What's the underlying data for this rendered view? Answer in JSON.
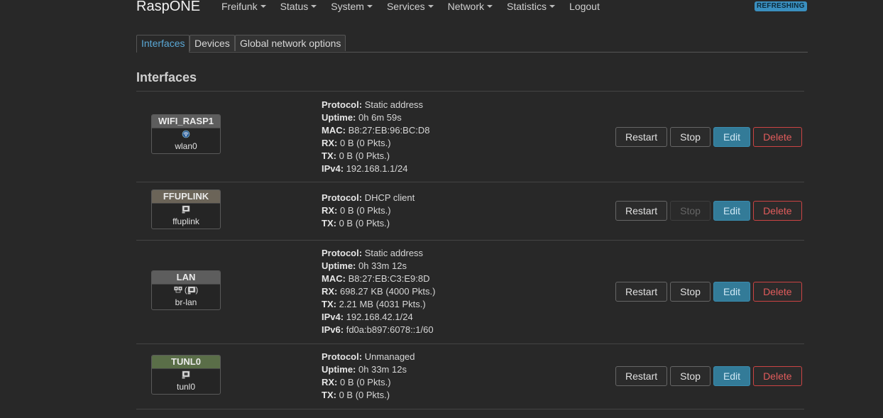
{
  "header": {
    "brand": "RaspONE",
    "nav": [
      "Freifunk",
      "Status",
      "System",
      "Services",
      "Network",
      "Statistics",
      "Logout"
    ],
    "badge": "REFRESHING"
  },
  "tabs": [
    "Interfaces",
    "Devices",
    "Global network options"
  ],
  "section_title": "Interfaces",
  "labels": {
    "protocol": "Protocol:",
    "uptime": "Uptime:",
    "mac": "MAC:",
    "rx": "RX:",
    "tx": "TX:",
    "ipv4": "IPv4:",
    "ipv6": "IPv6:"
  },
  "buttons": {
    "restart": "Restart",
    "stop": "Stop",
    "edit": "Edit",
    "delete": "Delete"
  },
  "colors": {
    "accent": "#3a8fbf",
    "delete": "#e25c5c"
  },
  "interfaces": [
    {
      "name": "WIFI_RASP1",
      "header_color": "#5d5d5d",
      "icon": "wifi-icon",
      "device": "wlan0",
      "protocol": "Static address",
      "uptime": "0h 6m 59s",
      "mac": "B8:27:EB:96:BC:D8",
      "rx": "0 B (0 Pkts.)",
      "tx": "0 B (0 Pkts.)",
      "ipv4": "192.168.1.1/24"
    },
    {
      "name": "FFUPLINK",
      "header_color": "#6b6458",
      "icon": "ethernet-port-icon",
      "device": "ffuplink",
      "protocol": "DHCP client",
      "rx": "0 B (0 Pkts.)",
      "tx": "0 B (0 Pkts.)",
      "stop_disabled": true
    },
    {
      "name": "LAN",
      "header_color": "#5d5d5d",
      "icon": "bridge-icon",
      "device": "br-lan",
      "protocol": "Static address",
      "uptime": "0h 33m 12s",
      "mac": "B8:27:EB:C3:E9:8D",
      "rx": "698.27 KB (4000 Pkts.)",
      "tx": "2.21 MB (4031 Pkts.)",
      "ipv4": "192.168.42.1/24",
      "ipv6": "fd0a:b897:6078::1/60"
    },
    {
      "name": "TUNL0",
      "header_color": "#5a6e48",
      "icon": "tunnel-icon",
      "device": "tunl0",
      "protocol": "Unmanaged",
      "uptime": "0h 33m 12s",
      "rx": "0 B (0 Pkts.)",
      "tx": "0 B (0 Pkts.)"
    }
  ]
}
